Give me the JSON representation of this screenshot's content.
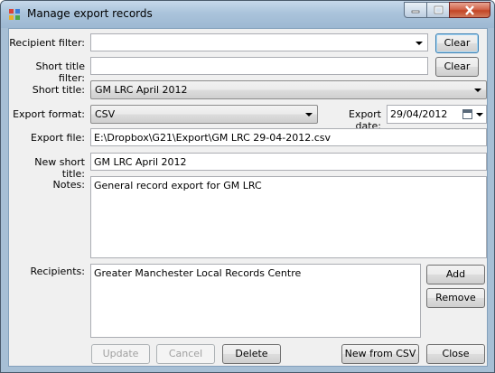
{
  "window": {
    "title": "Manage export records"
  },
  "labels": {
    "recipient_filter": "Recipient filter:",
    "short_title_filter": "Short title filter:",
    "short_title": "Short title:",
    "export_format": "Export format:",
    "export_date": "Export date:",
    "export_file": "Export file:",
    "new_short_title": "New short title:",
    "notes": "Notes:",
    "recipients": "Recipients:"
  },
  "fields": {
    "recipient_filter_value": "",
    "short_title_filter_value": "",
    "short_title_value": "GM LRC April 2012",
    "export_format_value": "CSV",
    "export_date_value": "29/04/2012",
    "export_file_value": "E:\\Dropbox\\G21\\Export\\GM LRC 29-04-2012.csv",
    "new_short_title_value": "GM LRC April 2012",
    "notes_value": "General record export for GM LRC"
  },
  "recipients": [
    "Greater Manchester Local Records Centre"
  ],
  "buttons": {
    "clear_recipient": "Clear",
    "clear_short_title": "Clear",
    "add": "Add",
    "remove": "Remove",
    "update": "Update",
    "cancel": "Cancel",
    "delete": "Delete",
    "new_from_csv": "New from CSV",
    "close": "Close"
  },
  "icons": [
    "app-icon",
    "minimize-icon",
    "maximize-icon",
    "close-icon",
    "calendar-icon",
    "chevron-down-icon"
  ]
}
